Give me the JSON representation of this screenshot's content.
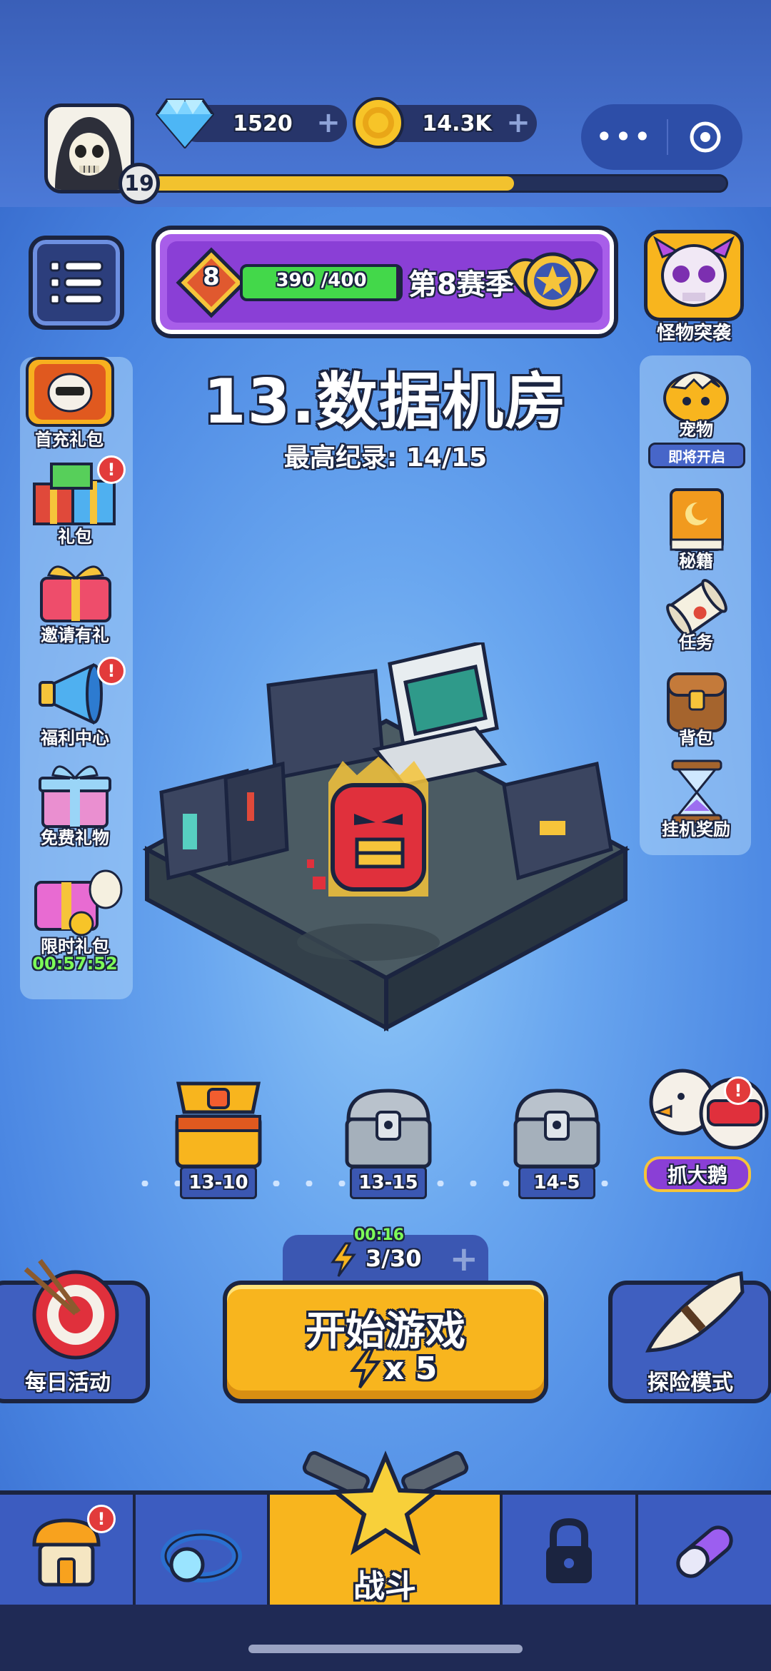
{
  "player": {
    "level": "19",
    "xp_progress": 0.63
  },
  "currencies": {
    "diamonds": "1520",
    "coins": "14.3K",
    "add_symbol": "+"
  },
  "capsule": {
    "more": "•••"
  },
  "season": {
    "tier": "8",
    "progress_text": "390 /400",
    "progress": 0.975,
    "label": "第8赛季"
  },
  "monster_raid": {
    "label": "怪物突袭"
  },
  "stage": {
    "title": "13.数据机房",
    "record_label": "最高纪录:",
    "record_value": "14/15"
  },
  "left_menu": [
    {
      "label": "首充礼包"
    },
    {
      "label": "礼包",
      "badge": "!"
    },
    {
      "label": "邀请有礼"
    },
    {
      "label": "福利中心",
      "badge": "!"
    },
    {
      "label": "免费礼物"
    },
    {
      "label": "限时礼包",
      "timer": "00:57:52"
    }
  ],
  "right_menu": [
    {
      "label": "宠物",
      "tag": "即将开启"
    },
    {
      "label": "秘籍"
    },
    {
      "label": "任务"
    },
    {
      "label": "背包"
    },
    {
      "label": "挂机奖励"
    }
  ],
  "chests": [
    {
      "label": "13-10",
      "state": "gold"
    },
    {
      "label": "13-15",
      "state": "silver"
    },
    {
      "label": "14-5",
      "state": "silver"
    }
  ],
  "catch_goose": {
    "label": "抓大鹅",
    "badge": "!"
  },
  "energy": {
    "timer": "00:16",
    "value": "3/30",
    "add_symbol": "+"
  },
  "start_button": {
    "label": "开始游戏",
    "cost": "x 5"
  },
  "daily_activity": {
    "label": "每日活动"
  },
  "adventure_mode": {
    "label": "探险模式"
  },
  "nav": {
    "tabs": [
      {
        "icon": "shop-icon",
        "badge": "!"
      },
      {
        "icon": "ring-icon"
      },
      {
        "icon": "star-guns-icon",
        "label": "战斗",
        "active": true
      },
      {
        "icon": "lock-icon"
      },
      {
        "icon": "capsule-icon"
      }
    ]
  },
  "colors": {
    "accent_yellow": "#f8b51e",
    "panel_blue": "#3b57b2",
    "season_purple": "#a85ee9",
    "badge_red": "#e23b3b",
    "timer_green": "#7dfc58"
  }
}
